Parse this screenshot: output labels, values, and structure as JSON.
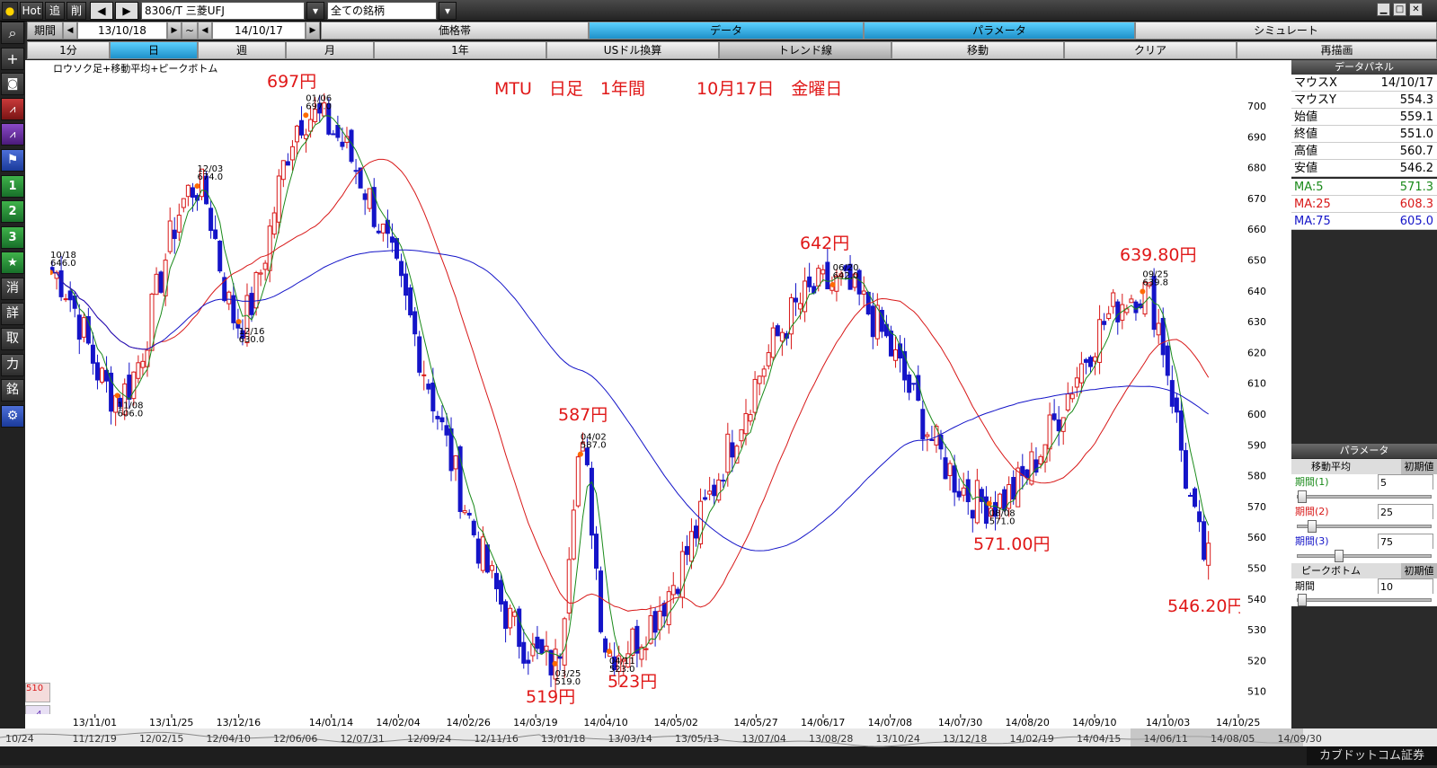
{
  "toolbar": {
    "hot_label": "Hot",
    "add_label": "追",
    "delete_label": "削",
    "prev_label": "◀",
    "next_label": "▶",
    "symbol_value": "8306/T 三菱UFJ",
    "list_value": "全ての銘柄",
    "window_min": "▁",
    "window_max": "□",
    "window_close": "✕"
  },
  "period_bar": {
    "period_label": "期間",
    "start_date": "13/10/18",
    "tilde": "~",
    "end_date": "14/10/17",
    "tabs": [
      "価格帯",
      "データ",
      "パラメータ",
      "シミュレート"
    ],
    "active_tab": "データ"
  },
  "sub_bar": {
    "items": [
      "1分",
      "日",
      "週",
      "月",
      "1年",
      "USドル換算",
      "トレンド線",
      "移動",
      "クリア",
      "再描画"
    ],
    "active": "日"
  },
  "sidebar": {
    "buttons": [
      "search-icon",
      "plus-icon",
      "camera-icon",
      "candle-chart-icon",
      "line-chart-icon",
      "flag-icon",
      "1",
      "2",
      "3",
      "★",
      "消",
      "詳",
      "取",
      "力",
      "銘",
      "gear-icon"
    ]
  },
  "chart": {
    "legend": "ロウソク足+移動平均+ピークボトム",
    "headline": "MTU　日足　1年間　　　10月17日　金曜日",
    "y_ticks": [
      700,
      690,
      680,
      670,
      660,
      650,
      640,
      630,
      620,
      610,
      600,
      590,
      580,
      570,
      560,
      550,
      540,
      530,
      520,
      510
    ],
    "x_ticks": [
      "13/11/01",
      "13/11/25",
      "13/12/16",
      "14/01/14",
      "14/02/04",
      "14/02/26",
      "14/03/19",
      "14/04/10",
      "14/05/02",
      "14/05/27",
      "14/06/17",
      "14/07/08",
      "14/07/30",
      "14/08/20",
      "14/09/10",
      "14/10/03",
      "14/10/25"
    ],
    "bottom_dates": [
      "10/24",
      "11/12/19",
      "12/02/15",
      "12/04/10",
      "12/06/06",
      "12/07/31",
      "12/09/24",
      "12/11/16",
      "13/01/18",
      "13/03/14",
      "13/05/13",
      "13/07/04",
      "13/08/28",
      "13/10/24",
      "13/12/18",
      "14/02/19",
      "14/04/15",
      "14/06/11",
      "14/08/05",
      "14/09/30"
    ],
    "bottom_brand": "カブドットコム証券",
    "bottom_price_label": "510",
    "peak_markers": [
      {
        "date": "10/18",
        "price": "646.0"
      },
      {
        "date": "11/08",
        "price": "606.0"
      },
      {
        "date": "12/03",
        "price": "674.0"
      },
      {
        "date": "12/16",
        "price": "630.0"
      },
      {
        "date": "01/06",
        "price": "697.0"
      },
      {
        "date": "03/25",
        "price": "519.0"
      },
      {
        "date": "04/02",
        "price": "587.0"
      },
      {
        "date": "04/11",
        "price": "523.0"
      },
      {
        "date": "06/20",
        "price": "642.0"
      },
      {
        "date": "08/08",
        "price": "571.0"
      },
      {
        "date": "09/25",
        "price": "639.8"
      }
    ],
    "annotations": [
      "697円",
      "587円",
      "519円",
      "523円",
      "642円",
      "571.00円",
      "639.80円",
      "546.20円"
    ]
  },
  "chart_data": {
    "type": "candlestick",
    "title": "MTU　日足　1年間　　　10月17日　金曜日",
    "ylim": [
      505,
      710
    ],
    "x_range": [
      "13/10/18",
      "14/10/25"
    ],
    "anchors": [
      {
        "date": "13/10/18",
        "price": 646
      },
      {
        "date": "13/11/08",
        "price": 606
      },
      {
        "date": "13/12/03",
        "price": 674
      },
      {
        "date": "13/12/16",
        "price": 630
      },
      {
        "date": "14/01/06",
        "price": 697
      },
      {
        "date": "14/03/25",
        "price": 519
      },
      {
        "date": "14/04/02",
        "price": 587
      },
      {
        "date": "14/04/11",
        "price": 523
      },
      {
        "date": "14/06/20",
        "price": 642
      },
      {
        "date": "14/08/08",
        "price": 571
      },
      {
        "date": "14/09/25",
        "price": 639.8
      },
      {
        "date": "14/10/17",
        "price": 551
      }
    ],
    "series": [
      {
        "name": "MA:5",
        "color": "#1a8a1a",
        "last": 571.3
      },
      {
        "name": "MA:25",
        "color": "#d81818",
        "last": 608.3
      },
      {
        "name": "MA:75",
        "color": "#1414c8",
        "last": 605.0
      }
    ]
  },
  "data_panel": {
    "title": "データパネル",
    "rows": [
      {
        "label": "マウスX",
        "value": "14/10/17"
      },
      {
        "label": "マウスY",
        "value": "554.3"
      },
      {
        "label": "始値",
        "value": "559.1"
      },
      {
        "label": "終値",
        "value": "551.0"
      },
      {
        "label": "高値",
        "value": "560.7"
      },
      {
        "label": "安値",
        "value": "546.2"
      }
    ],
    "ma_rows": [
      {
        "label": "MA:5",
        "value": "571.3",
        "color": "#1a8a1a"
      },
      {
        "label": "MA:25",
        "value": "608.3",
        "color": "#d81818"
      },
      {
        "label": "MA:75",
        "value": "605.0",
        "color": "#1414c8"
      }
    ]
  },
  "param_panel": {
    "title": "パラメータ",
    "ma_header": "移動平均",
    "reset_label": "初期値",
    "periods": [
      {
        "label": "期間(1)",
        "value": "5",
        "color": "#1a8a1a",
        "level": 0.0
      },
      {
        "label": "期間(2)",
        "value": "25",
        "color": "#d81818",
        "level": 0.08
      },
      {
        "label": "期間(3)",
        "value": "75",
        "color": "#1414c8",
        "level": 0.3
      }
    ],
    "pb_header": "ピークボトム",
    "pb_label": "期間",
    "pb_value": "10",
    "pb_level": 0.0
  }
}
